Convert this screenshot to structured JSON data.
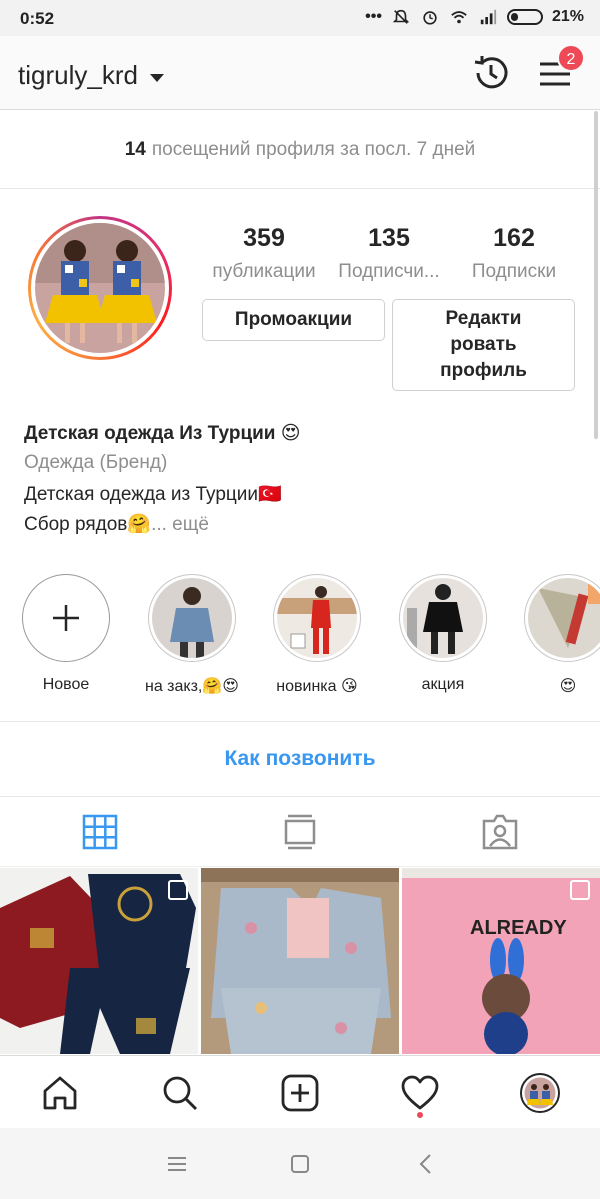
{
  "status_bar": {
    "time": "0:52",
    "battery": "21%"
  },
  "header": {
    "username": "tigruly_krd",
    "notifications_badge": "2"
  },
  "visits": {
    "count": "14",
    "text": "посещений профиля за посл. 7 дней"
  },
  "stats": [
    {
      "value": "359",
      "label": "публикации"
    },
    {
      "value": "135",
      "label": "Подписчи..."
    },
    {
      "value": "162",
      "label": "Подписки"
    }
  ],
  "buttons": {
    "promo": "Промоакции",
    "edit_line1": "Редакти",
    "edit_line2": "ровать",
    "edit_line3": "профиль"
  },
  "bio": {
    "name": "Детская одежда Из Турции 😍",
    "category": "Одежда (Бренд)",
    "line1": "Детская одежда из Турции🇹🇷",
    "line2": "Сбор рядов🤗",
    "more": "... ещё"
  },
  "highlights": [
    {
      "label": "Новое"
    },
    {
      "label": "на закз,🤗😍"
    },
    {
      "label": "новинка 😘"
    },
    {
      "label": "акция"
    },
    {
      "label": "😍"
    }
  ],
  "call_link": "Как позвонить",
  "colors": {
    "accent": "#3897f0",
    "badge": "#ed4956",
    "muted": "#8e8e8e"
  }
}
